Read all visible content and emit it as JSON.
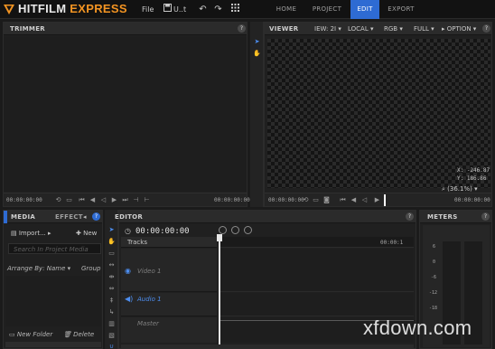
{
  "app": {
    "brand_primary": "HITFILM",
    "brand_secondary": "EXPRESS",
    "brand_color": "#f39422",
    "accent": "#2e6bd3"
  },
  "toolbar": {
    "file_label": "File",
    "save_label": "U..t",
    "icons": [
      "save-icon",
      "undo-icon",
      "redo-icon",
      "grid-icon"
    ]
  },
  "tabs": [
    {
      "label": "HOME",
      "active": false
    },
    {
      "label": "PROJECT",
      "active": false
    },
    {
      "label": "EDIT",
      "active": true
    },
    {
      "label": "EXPORT",
      "active": false
    }
  ],
  "trimmer": {
    "title": "TRIMMER",
    "help": "?",
    "timecode_left": "00:00:00:00",
    "timecode_right": "00:00:00:00"
  },
  "viewer": {
    "title": "VIEWER",
    "view_label": "IEW: 2I",
    "layout_label": "LOCAL",
    "color_label": "RGB",
    "quality_label": "FULL",
    "options_label": "OPTION",
    "help": "?",
    "coord_x": "X:  -246.87",
    "coord_y": "Y:    186.86",
    "zoom_label": "(36.1%)",
    "timecode_left": "00:00:00:00",
    "timecode_right": "00:00:00:00"
  },
  "media": {
    "tab_media": "MEDIA",
    "tab_effects": "EFFECT",
    "help": "?",
    "import_label": "Import...",
    "new_label": "New",
    "search_placeholder": "Search In Project Media",
    "arrange_label": "Arrange By: Name",
    "group_label": "Group",
    "new_folder_label": "New Folder",
    "delete_label": "Delete"
  },
  "editor": {
    "title": "EDITOR",
    "help": "?",
    "timecode": "00:00:00:00",
    "ruler_time": "00:00:1",
    "tracks_header": "Tracks",
    "tracks": [
      {
        "name": "Video 1",
        "kind": "video"
      },
      {
        "name": "Audio 1",
        "kind": "audio"
      },
      {
        "name": "Master",
        "kind": "master"
      }
    ]
  },
  "meters": {
    "title": "METERS",
    "help": "?",
    "scale": [
      "6",
      "0",
      "-6",
      "-12",
      "-18"
    ]
  },
  "watermark": "xfdown.com"
}
